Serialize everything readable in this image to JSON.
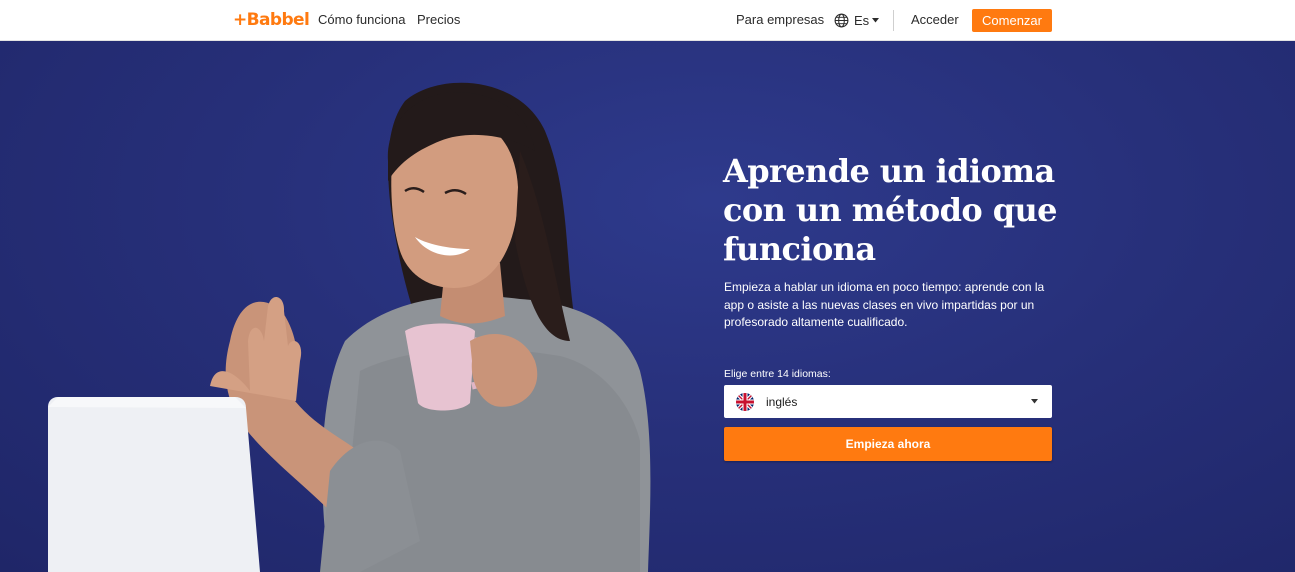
{
  "colors": {
    "brand_orange": "#ff7a10",
    "hero_blue": "#27307a",
    "white": "#ffffff"
  },
  "header": {
    "logo_text": "+Babbel",
    "nav_left": [
      "Cómo funciona",
      "Precios"
    ],
    "business_link": "Para empresas",
    "language": {
      "icon": "globe-icon",
      "label": "Es"
    },
    "login": "Acceder",
    "cta": "Comenzar"
  },
  "hero": {
    "title_lines": [
      "Aprende un idioma",
      "con un método que",
      "funciona"
    ],
    "subtitle": "Empieza a hablar un idioma en poco tiempo: aprende con la app o asiste a las nuevas clases en vivo impartidas por un profesorado altamente cualificado.",
    "picker_label": "Elige entre 14 idiomas:",
    "selected_language": "inglés",
    "selected_flag_icon": "uk-flag-icon",
    "cta": "Empieza ahora"
  }
}
